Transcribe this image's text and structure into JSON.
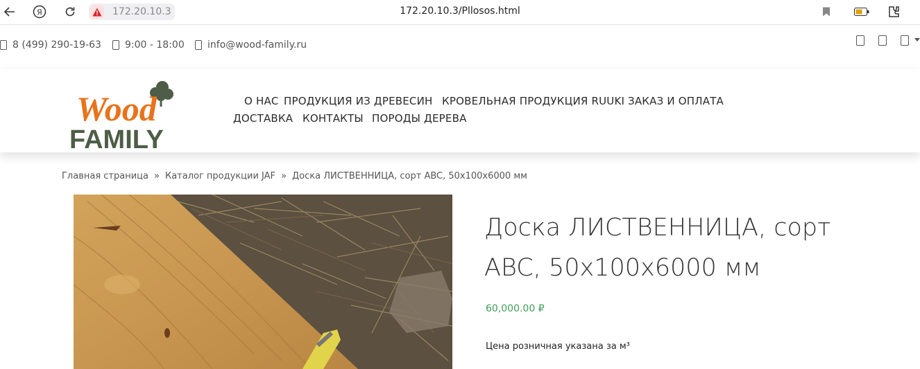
{
  "browser": {
    "host_chip": "172.20.10.3",
    "url": "172.20.10.3/Pllosos.html",
    "icons": [
      "back-icon",
      "yandex-icon",
      "reload-icon",
      "warning-icon",
      "bookmark-icon",
      "battery-icon",
      "extension-icon"
    ]
  },
  "topbar": {
    "phone": "8 (499) 290-19-63",
    "hours": "9:00 - 18:00",
    "email": "info@wood-family.ru"
  },
  "logo": {
    "line1": "Wood",
    "line2": "FAMILY"
  },
  "menu": [
    {
      "label": "О НАС"
    },
    {
      "label": "ПРОДУКЦИЯ ИЗ ДРЕВЕСИН"
    },
    {
      "label": "КРОВЕЛЬНАЯ ПРОДУКЦИЯ RUUKI"
    },
    {
      "label": "ЗАКАЗ И ОПЛАТА"
    },
    {
      "label": "ДОСТАВКА"
    },
    {
      "label": "КОНТАКТЫ"
    },
    {
      "label": "ПОРОДЫ ДЕРЕВА"
    }
  ],
  "breadcrumb": {
    "home": "Главная страница",
    "catalog": "Каталог продукции JAF",
    "current": "Доска ЛИСТВЕННИЦА, сорт ABC, 50x100x6000 мм",
    "separator": "»"
  },
  "product": {
    "title_line1": "Доска ЛИСТВЕННИЦА, сорт",
    "title_line2": "ABC, 50x100x6000 мм",
    "price": "60,000.00 ₽",
    "note": "Цена розничная указана за м³"
  },
  "colors": {
    "logo_orange": "#e8731c",
    "logo_green": "#4d5d47",
    "price_green": "#3e9e56"
  }
}
